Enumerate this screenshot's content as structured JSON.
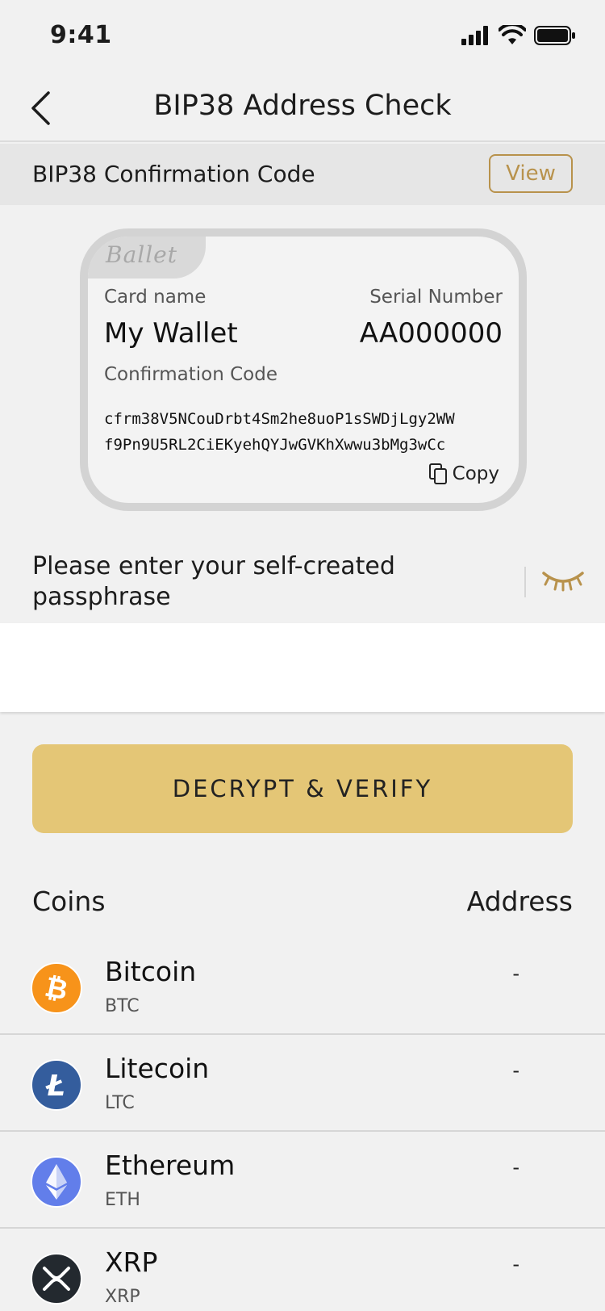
{
  "status": {
    "time": "9:41"
  },
  "nav": {
    "title": "BIP38 Address Check"
  },
  "section": {
    "title": "BIP38 Confirmation Code",
    "view_label": "View"
  },
  "card": {
    "logo": "Ballet",
    "card_name_label": "Card name",
    "card_name": "My Wallet",
    "serial_label": "Serial Number",
    "serial": "AA000000",
    "code_label": "Confirmation Code",
    "code_line1": "cfrm38V5NCouDrbt4Sm2he8uoP1sSWDjLgy2WW",
    "code_line2": "f9Pn9U5RL2CiEKyehQYJwGVKhXwwu3bMg3wCc",
    "copy_label": "Copy"
  },
  "passphrase": {
    "label": "Please enter your self-created passphrase",
    "value": ""
  },
  "decrypt": {
    "label": "DECRYPT & VERIFY"
  },
  "coins": {
    "coins_header": "Coins",
    "address_header": "Address",
    "items": [
      {
        "name": "Bitcoin",
        "symbol": "BTC",
        "address": "-",
        "color": "#f7931a",
        "icon": "bitcoin-icon"
      },
      {
        "name": "Litecoin",
        "symbol": "LTC",
        "address": "-",
        "color": "#345d9d",
        "icon": "litecoin-icon"
      },
      {
        "name": "Ethereum",
        "symbol": "ETH",
        "address": "-",
        "color": "#627eea",
        "icon": "ethereum-icon"
      },
      {
        "name": "XRP",
        "symbol": "XRP",
        "address": "-",
        "color": "#23292f",
        "icon": "xrp-icon"
      }
    ]
  },
  "colors": {
    "accent": "#b8924c",
    "button": "#e4c676"
  }
}
